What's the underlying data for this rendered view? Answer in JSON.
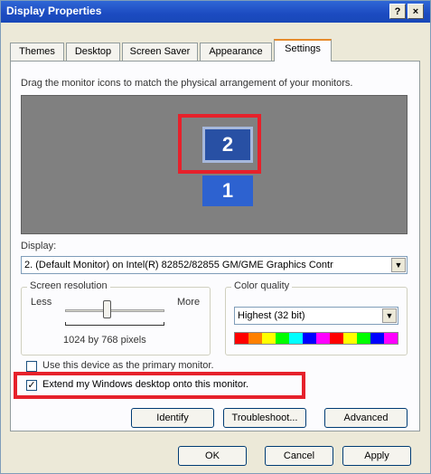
{
  "window": {
    "title": "Display Properties",
    "help_button": "?",
    "close_button": "×"
  },
  "tabs": [
    {
      "label": "Themes"
    },
    {
      "label": "Desktop"
    },
    {
      "label": "Screen Saver"
    },
    {
      "label": "Appearance"
    },
    {
      "label": "Settings",
      "active": true
    }
  ],
  "settings": {
    "instruction": "Drag the monitor icons to match the physical arrangement of your monitors.",
    "monitors": [
      {
        "label": "2",
        "selected": true
      },
      {
        "label": "1",
        "selected": false
      }
    ],
    "display_label": "Display:",
    "display_value": "2. (Default Monitor) on Intel(R) 82852/82855 GM/GME Graphics Contr",
    "screen_resolution": {
      "title": "Screen resolution",
      "less_label": "Less",
      "more_label": "More",
      "value_text": "1024 by 768 pixels",
      "slider_position": 0.3
    },
    "color_quality": {
      "title": "Color quality",
      "selected": "Highest (32 bit)",
      "palette": [
        "#ff0000",
        "#ff8000",
        "#ffff00",
        "#00ff00",
        "#00ffff",
        "#0000ff",
        "#ff00ff",
        "#ff0000",
        "#ffff00",
        "#00ff00",
        "#0000ff",
        "#ff00ff"
      ]
    },
    "primary_checkbox": {
      "label": "Use this device as the primary monitor.",
      "checked": false
    },
    "extend_checkbox": {
      "label": "Extend my Windows desktop onto this monitor.",
      "checked": true
    },
    "buttons": {
      "identify": "Identify",
      "troubleshoot": "Troubleshoot...",
      "advanced": "Advanced"
    }
  },
  "footer": {
    "ok": "OK",
    "cancel": "Cancel",
    "apply": "Apply"
  },
  "colors": {
    "highlight": "#e6212b",
    "title_bar": "#1c4bc1"
  }
}
